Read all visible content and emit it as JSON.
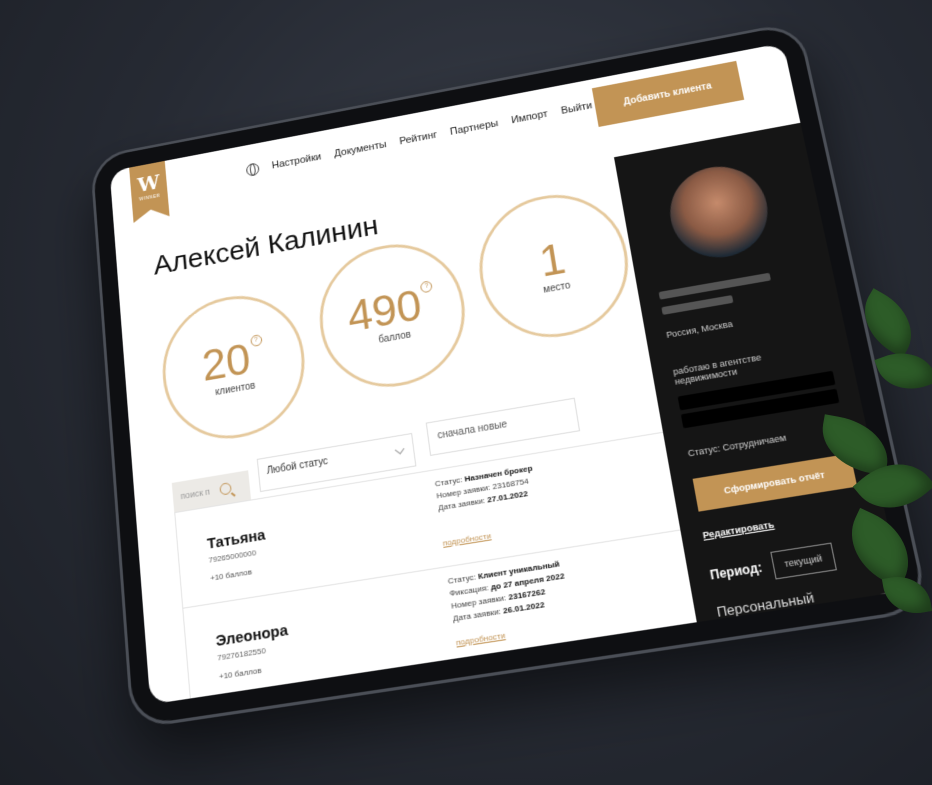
{
  "brand": {
    "logo_letter": "W",
    "logo_sub": "WINNER"
  },
  "nav": {
    "items": [
      "Настройки",
      "Документы",
      "Рейтинг",
      "Партнеры",
      "Импорт",
      "Выйти"
    ],
    "add_button": "Добавить клиента"
  },
  "profile": {
    "name": "Алексей Калинин"
  },
  "stats": [
    {
      "value": "20",
      "label": "клиентов",
      "has_help": true
    },
    {
      "value": "490",
      "label": "баллов",
      "has_help": true
    },
    {
      "value": "1",
      "label": "место",
      "has_help": false
    }
  ],
  "filters": {
    "search_placeholder": "поиск п",
    "status_select": "Любой статус",
    "sort_select": "сначала новые"
  },
  "clients": [
    {
      "name": "Татьяна",
      "phone": "79265000000",
      "points": "+10 баллов",
      "status_label": "Статус:",
      "status": "Назначен брокер",
      "request_label": "Номер заявки:",
      "request": "23168754",
      "date_label": "Дата заявки:",
      "date": "27.01.2022",
      "details_link": "подробности"
    },
    {
      "name": "Элеонора",
      "phone": "79276182550",
      "points": "+10 баллов",
      "status_label": "Статус:",
      "status": "Клиент уникальный",
      "fixation_label": "Фиксация:",
      "fixation": "до 27 апреля 2022",
      "request_label": "Номер заявки:",
      "request": "23167262",
      "date_label": "Дата заявки:",
      "date": "26.01.2022",
      "details_link": "подробности"
    }
  ],
  "sidebar": {
    "location": "Россия, Москва",
    "work": "работаю в агентстве недвижимости",
    "status": "Статус: Сотрудничаем",
    "report_button": "Сформировать отчёт",
    "edit_link": "Редактировать",
    "period_label": "Период:",
    "period_value": "текущий",
    "manager": "Персональный менеджер: Анна Чурсина"
  },
  "colors": {
    "accent": "#c29455",
    "sidebar_bg": "#151515",
    "background": "#2b2f38"
  }
}
